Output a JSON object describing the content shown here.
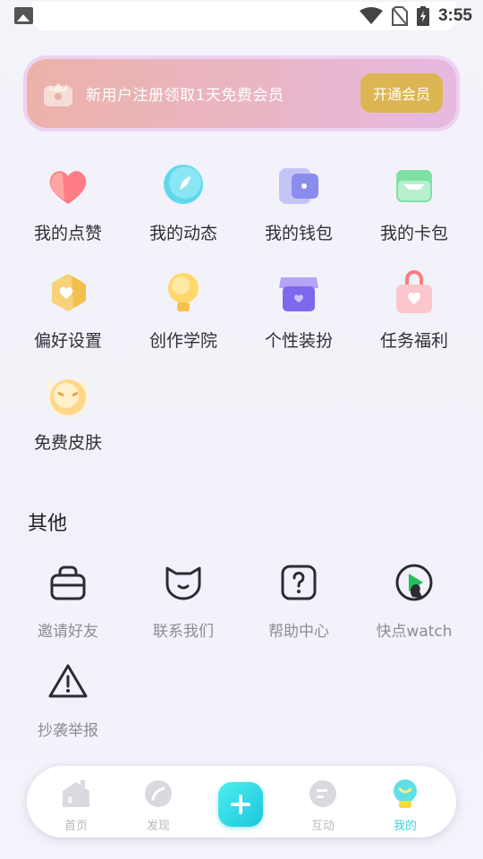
{
  "status_bar": {
    "time": "3:55"
  },
  "vip_banner": {
    "text": "新用户注册领取1天免费会员",
    "button": "开通会员"
  },
  "features": [
    {
      "label": "我的点赞",
      "icon": "heart-icon"
    },
    {
      "label": "我的动态",
      "icon": "compass-icon"
    },
    {
      "label": "我的钱包",
      "icon": "wallet-icon"
    },
    {
      "label": "我的卡包",
      "icon": "card-icon"
    },
    {
      "label": "偏好设置",
      "icon": "hexagon-heart-icon"
    },
    {
      "label": "创作学院",
      "icon": "lightbulb-icon"
    },
    {
      "label": "个性装扮",
      "icon": "shop-icon"
    },
    {
      "label": "任务福利",
      "icon": "gift-bag-icon"
    },
    {
      "label": "免费皮肤",
      "icon": "mascot-icon"
    }
  ],
  "other": {
    "title": "其他",
    "items": [
      {
        "label": "邀请好友",
        "icon": "invite-icon"
      },
      {
        "label": "联系我们",
        "icon": "cat-face-icon"
      },
      {
        "label": "帮助中心",
        "icon": "question-icon"
      },
      {
        "label": "快点watch",
        "icon": "watch-play-icon"
      },
      {
        "label": "抄袭举报",
        "icon": "warning-icon"
      }
    ]
  },
  "bottom_nav": {
    "items": [
      {
        "label": "首页",
        "icon": "home-icon"
      },
      {
        "label": "发现",
        "icon": "discover-icon"
      },
      {
        "label": "互动",
        "icon": "chat-icon"
      },
      {
        "label": "我的",
        "icon": "profile-icon"
      }
    ],
    "active": "我的"
  },
  "colors": {
    "accent": "#3fd3e0",
    "vip_button": "#ddb653"
  }
}
